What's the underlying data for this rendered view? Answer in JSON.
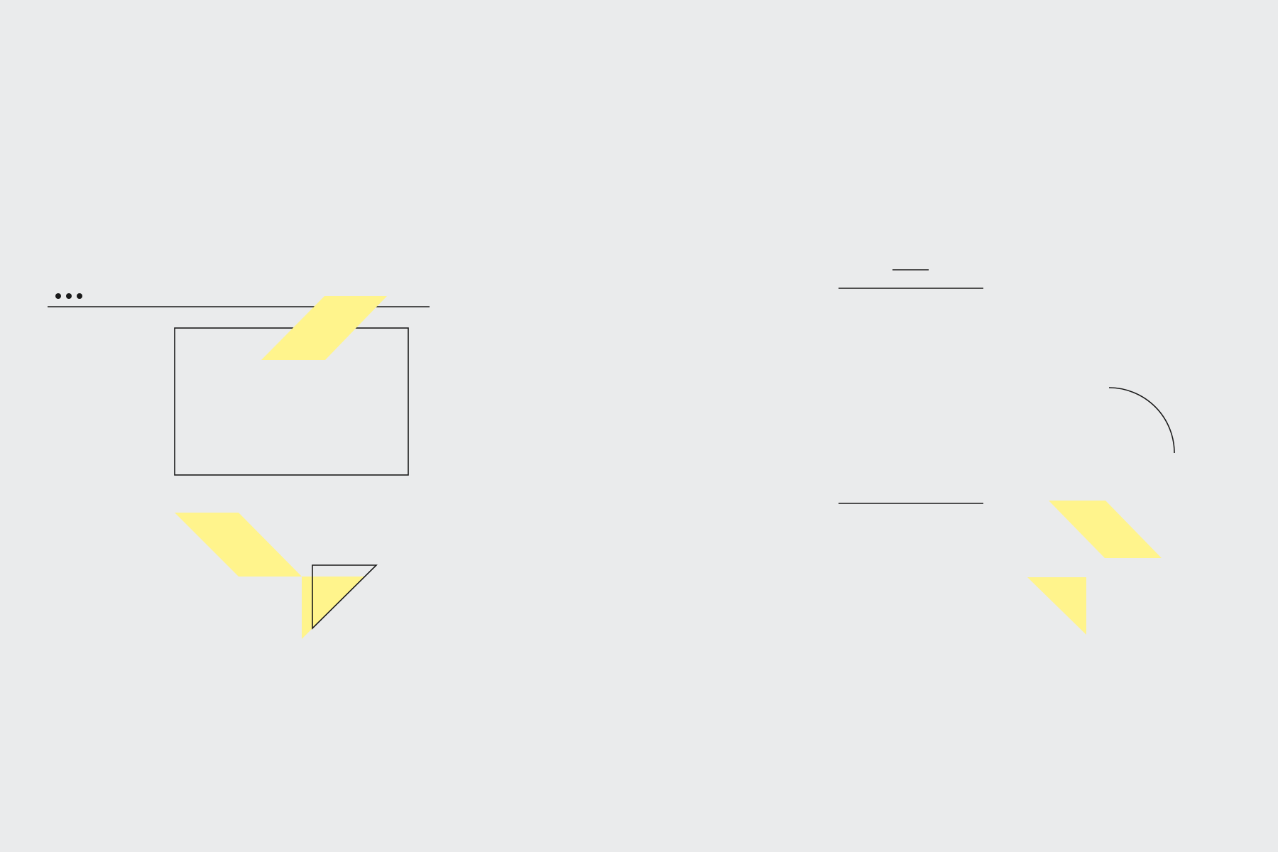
{
  "colors": {
    "background": "#eaebec",
    "accent_yellow": "#fff48c",
    "stroke": "#1a1a1a"
  },
  "illustrations": [
    {
      "name": "browser-window-with-cloud",
      "icons": [
        "browser-window-icon",
        "cloud-icon",
        "cursor-arrow-icon",
        "lightning-bolt-icon"
      ]
    },
    {
      "name": "mobile-phone-with-cloud",
      "icons": [
        "smartphone-icon",
        "cloud-icon",
        "lightning-bolt-icon"
      ]
    }
  ]
}
